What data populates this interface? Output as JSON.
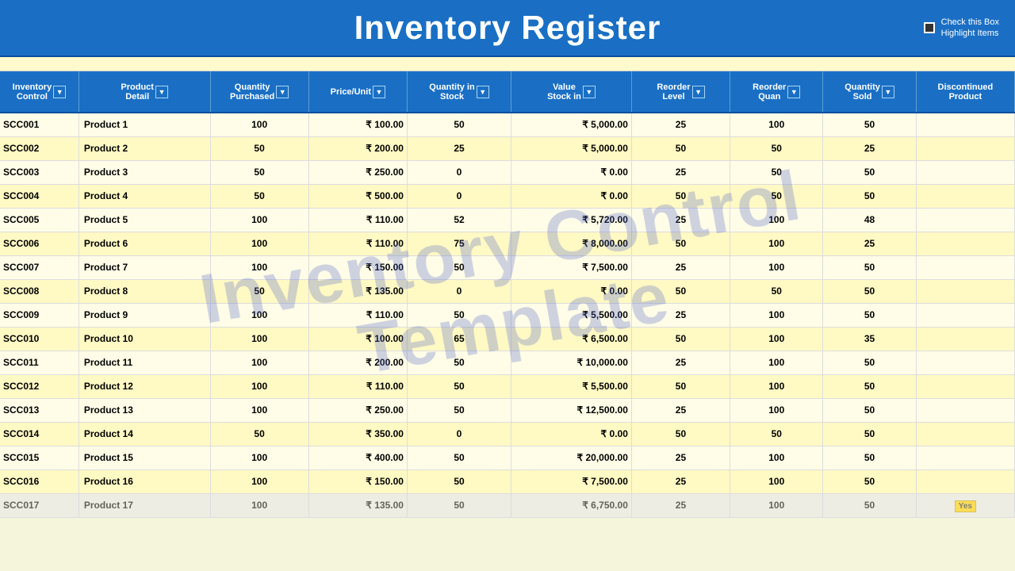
{
  "header": {
    "title": "Inventory Register",
    "checkbox_label": "Check this Box\nHighlight Items"
  },
  "columns": [
    {
      "key": "inv_control",
      "label": "Inventory\nControl",
      "has_dropdown": true
    },
    {
      "key": "product_detail",
      "label": "Product\nDetail",
      "has_dropdown": true
    },
    {
      "key": "qty_purchase",
      "label": "Quantity\nPurchased",
      "has_dropdown": true
    },
    {
      "key": "price_unit",
      "label": "Price/Unit",
      "has_dropdown": true
    },
    {
      "key": "qty_stock",
      "label": "Quantity in\nStock",
      "has_dropdown": true
    },
    {
      "key": "value_stock",
      "label": "Value\nStock in",
      "has_dropdown": true
    },
    {
      "key": "reorder_level",
      "label": "Reorder\nLevel",
      "has_dropdown": true
    },
    {
      "key": "reorder_quan",
      "label": "Reorder\nQuan",
      "has_dropdown": true
    },
    {
      "key": "qty_sold",
      "label": "Quantity\nSold",
      "has_dropdown": true
    },
    {
      "key": "discont_prod",
      "label": "Discontinued\nProduct",
      "has_dropdown": false
    }
  ],
  "rows": [
    {
      "inv": "C001",
      "product": "Product 1",
      "qty_pur": 100,
      "price": "₹ 100.00",
      "qty_stock": 50,
      "val_stock": "₹ 5,000.00",
      "r_level": 25,
      "r_quan": 100,
      "qty_sold": 50,
      "disc": ""
    },
    {
      "inv": "C002",
      "product": "Product 2",
      "qty_pur": 50,
      "price": "₹ 200.00",
      "qty_stock": 25,
      "val_stock": "₹ 5,000.00",
      "r_level": 50,
      "r_quan": 50,
      "qty_sold": 25,
      "disc": ""
    },
    {
      "inv": "C003",
      "product": "Product 3",
      "qty_pur": 50,
      "price": "₹ 250.00",
      "qty_stock": 0,
      "val_stock": "₹ 0.00",
      "r_level": 25,
      "r_quan": 50,
      "qty_sold": 50,
      "disc": ""
    },
    {
      "inv": "C004",
      "product": "Product 4",
      "qty_pur": 50,
      "price": "₹ 500.00",
      "qty_stock": 0,
      "val_stock": "₹ 0.00",
      "r_level": 50,
      "r_quan": 50,
      "qty_sold": 50,
      "disc": ""
    },
    {
      "inv": "C005",
      "product": "Product 5",
      "qty_pur": 100,
      "price": "₹ 110.00",
      "qty_stock": 52,
      "val_stock": "₹ 5,720.00",
      "r_level": 25,
      "r_quan": 100,
      "qty_sold": 48,
      "disc": ""
    },
    {
      "inv": "C006",
      "product": "Product 6",
      "qty_pur": 100,
      "price": "₹ 110.00",
      "qty_stock": 75,
      "val_stock": "₹ 8,000.00",
      "r_level": 50,
      "r_quan": 100,
      "qty_sold": 25,
      "disc": ""
    },
    {
      "inv": "C007",
      "product": "Product 7",
      "qty_pur": 100,
      "price": "₹ 150.00",
      "qty_stock": 50,
      "val_stock": "₹ 7,500.00",
      "r_level": 25,
      "r_quan": 100,
      "qty_sold": 50,
      "disc": ""
    },
    {
      "inv": "C008",
      "product": "Product 8",
      "qty_pur": 50,
      "price": "₹ 135.00",
      "qty_stock": 0,
      "val_stock": "₹ 0.00",
      "r_level": 50,
      "r_quan": 50,
      "qty_sold": 50,
      "disc": ""
    },
    {
      "inv": "C009",
      "product": "Product 9",
      "qty_pur": 100,
      "price": "₹ 110.00",
      "qty_stock": 50,
      "val_stock": "₹ 5,500.00",
      "r_level": 25,
      "r_quan": 100,
      "qty_sold": 50,
      "disc": ""
    },
    {
      "inv": "C010",
      "product": "Product 10",
      "qty_pur": 100,
      "price": "₹ 100.00",
      "qty_stock": 65,
      "val_stock": "₹ 6,500.00",
      "r_level": 50,
      "r_quan": 100,
      "qty_sold": 35,
      "disc": ""
    },
    {
      "inv": "C011",
      "product": "Product 11",
      "qty_pur": 100,
      "price": "₹ 200.00",
      "qty_stock": 50,
      "val_stock": "₹ 10,000.00",
      "r_level": 25,
      "r_quan": 100,
      "qty_sold": 50,
      "disc": ""
    },
    {
      "inv": "C012",
      "product": "Product 12",
      "qty_pur": 100,
      "price": "₹ 110.00",
      "qty_stock": 50,
      "val_stock": "₹ 5,500.00",
      "r_level": 50,
      "r_quan": 100,
      "qty_sold": 50,
      "disc": ""
    },
    {
      "inv": "C013",
      "product": "Product 13",
      "qty_pur": 100,
      "price": "₹ 250.00",
      "qty_stock": 50,
      "val_stock": "₹ 12,500.00",
      "r_level": 25,
      "r_quan": 100,
      "qty_sold": 50,
      "disc": ""
    },
    {
      "inv": "C014",
      "product": "Product 14",
      "qty_pur": 50,
      "price": "₹ 350.00",
      "qty_stock": 0,
      "val_stock": "₹ 0.00",
      "r_level": 50,
      "r_quan": 50,
      "qty_sold": 50,
      "disc": ""
    },
    {
      "inv": "C015",
      "product": "Product 15",
      "qty_pur": 100,
      "price": "₹ 400.00",
      "qty_stock": 50,
      "val_stock": "₹ 20,000.00",
      "r_level": 25,
      "r_quan": 100,
      "qty_sold": 50,
      "disc": ""
    },
    {
      "inv": "C016",
      "product": "Product 16",
      "qty_pur": 100,
      "price": "₹ 150.00",
      "qty_stock": 50,
      "val_stock": "₹ 7,500.00",
      "r_level": 25,
      "r_quan": 100,
      "qty_sold": 50,
      "disc": ""
    },
    {
      "inv": "C017",
      "product": "Product 17",
      "qty_pur": 100,
      "price": "₹ 135.00",
      "qty_stock": 50,
      "val_stock": "₹ 6,750.00",
      "r_level": 25,
      "r_quan": 100,
      "qty_sold": 50,
      "disc": "Yes"
    }
  ],
  "watermark": {
    "line1": "Inventory Control",
    "line2": "Template"
  },
  "prefix": "SC"
}
